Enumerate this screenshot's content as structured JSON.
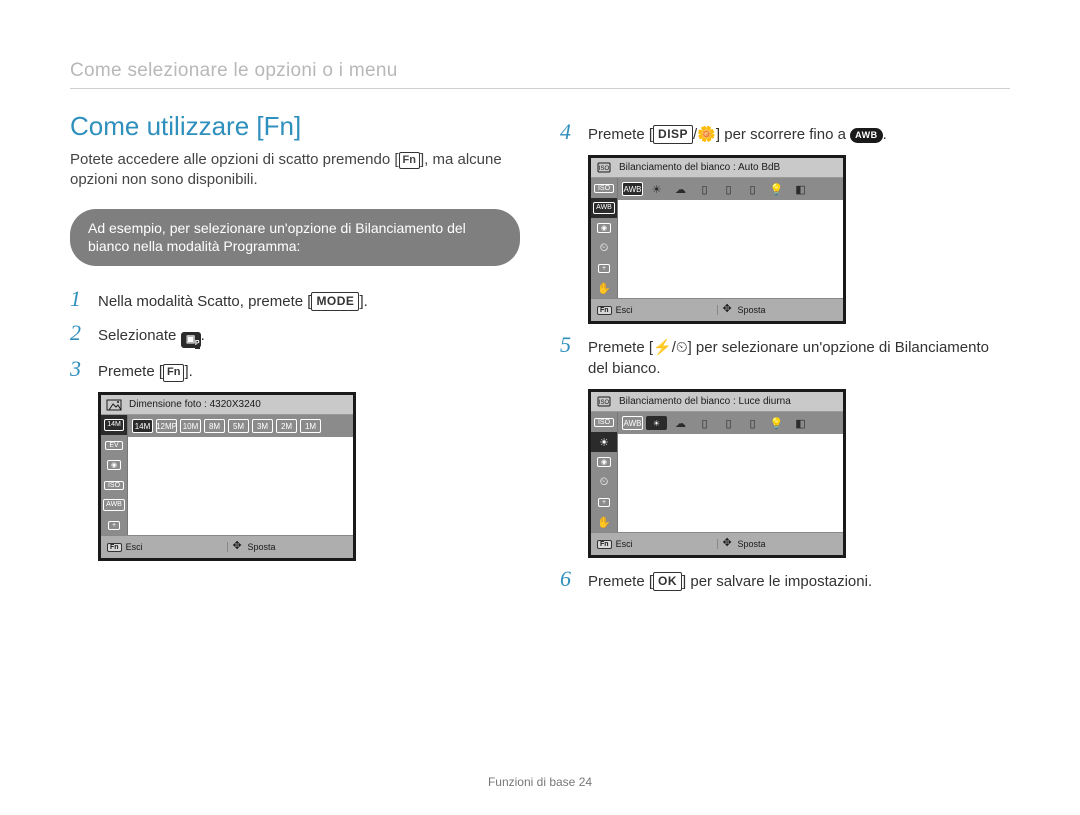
{
  "breadcrumb": "Come selezionare le opzioni o i menu",
  "section_title": "Come utilizzare [Fn]",
  "intro": {
    "part1": "Potete accedere alle opzioni di scatto premendo [",
    "fn_label": "Fn",
    "part2": "], ma alcune opzioni non sono disponibili."
  },
  "callout": "Ad esempio, per selezionare un'opzione di Bilanciamento del bianco nella modalità Programma:",
  "steps": {
    "s1": {
      "num": "1",
      "t1": "Nella modalità Scatto, premete [",
      "mode_label": "MODE",
      "t2": "]."
    },
    "s2": {
      "num": "2",
      "t1": "Selezionate ",
      "t2": "."
    },
    "s3": {
      "num": "3",
      "t1": "Premete [",
      "fn_label": "Fn",
      "t2": "]."
    },
    "s4": {
      "num": "4",
      "t1": "Premete [",
      "disp_label": "DISP",
      "t2": "/",
      "t3": "] per scorrere fino a ",
      "awb_label": "AWB",
      "t4": "."
    },
    "s5": {
      "num": "5",
      "t1": "Premete [",
      "t2": "/",
      "t3": "] per selezionare un'opzione di Bilanciamento del bianco."
    },
    "s6": {
      "num": "6",
      "t1": "Premete [",
      "ok_label": "OK",
      "t2": "] per salvare le impostazioni."
    }
  },
  "screens": {
    "s3": {
      "top_label": "Dimensione foto : 4320X3240",
      "options": [
        "14M",
        "12MP",
        "10M",
        "8M",
        "5M",
        "3M",
        "2M",
        "1M"
      ],
      "active_index": 0,
      "left_icons": [
        "14M",
        "EV",
        "◉",
        "ISO",
        "AWB",
        "+"
      ],
      "left_active_index": 0,
      "bottom_left": "Esci",
      "bottom_right": "Sposta",
      "fn": "Fn"
    },
    "s4": {
      "top_label": "Bilanciamento del bianco : Auto BdB",
      "icons": [
        "AWB",
        "sun",
        "cloud",
        "bulb-d",
        "bulb-l",
        "bulb-h",
        "tungsten",
        "custom"
      ],
      "active_index": 0,
      "left_icons": [
        "ISO",
        "AWB",
        "◉",
        "timer",
        "+",
        "hand"
      ],
      "left_active_index": 1,
      "bottom_left": "Esci",
      "bottom_right": "Sposta",
      "fn": "Fn"
    },
    "s5": {
      "top_label": "Bilanciamento del bianco : Luce diurna",
      "icons": [
        "AWB",
        "sun",
        "cloud",
        "bulb-d",
        "bulb-l",
        "bulb-h",
        "tungsten",
        "custom"
      ],
      "active_index": 1,
      "left_icons": [
        "ISO",
        "sun",
        "◉",
        "timer",
        "+",
        "hand"
      ],
      "left_active_index": 1,
      "bottom_left": "Esci",
      "bottom_right": "Sposta",
      "fn": "Fn"
    }
  },
  "footer": {
    "label": "Funzioni di base",
    "page": "24"
  }
}
